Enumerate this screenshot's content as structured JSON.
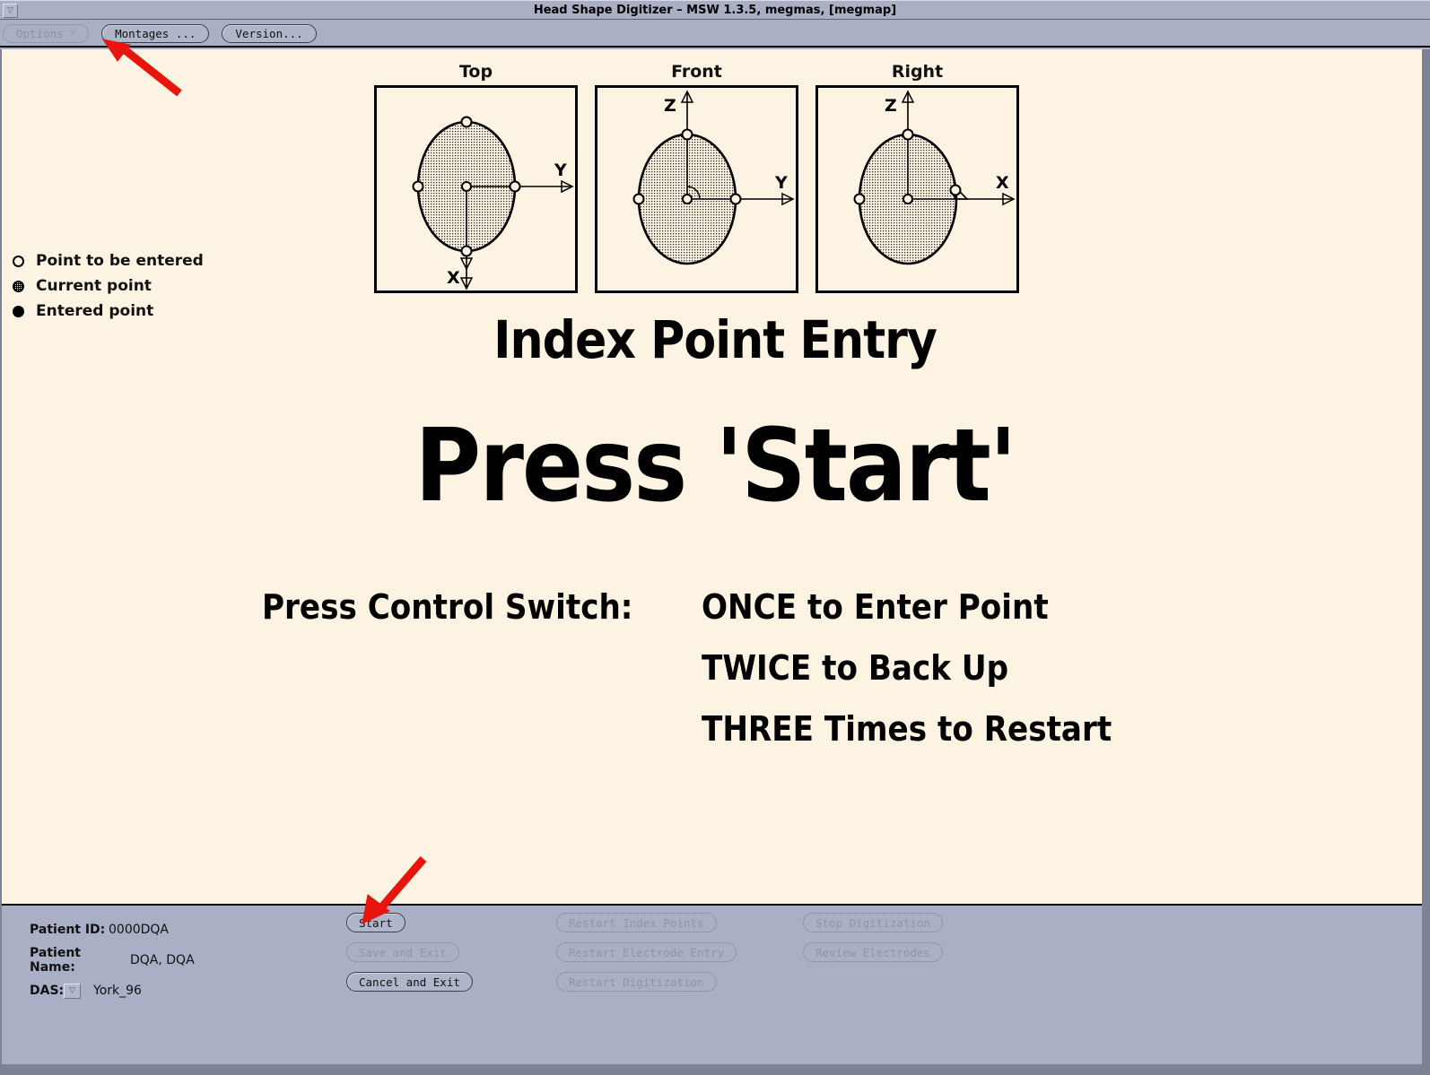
{
  "window": {
    "title": "Head Shape Digitizer – MSW 1.3.5, megmas, [megmap]",
    "handle_icon": "▽"
  },
  "menubar": {
    "items": [
      {
        "label": "Options",
        "caret": "▽",
        "enabled": false
      },
      {
        "label": "Montages ...",
        "caret": "",
        "enabled": true
      },
      {
        "label": "Version...",
        "caret": "",
        "enabled": true
      }
    ]
  },
  "views": [
    {
      "name": "Top",
      "axis_h": "Y",
      "axis_v": "X"
    },
    {
      "name": "Front",
      "axis_h": "Y",
      "axis_v": "Z"
    },
    {
      "name": "Right",
      "axis_h": "X",
      "axis_v": "Z"
    }
  ],
  "legend": [
    {
      "marker": "open-circle",
      "label": "Point to be entered"
    },
    {
      "marker": "stippled-circle",
      "label": "Current point"
    },
    {
      "marker": "filled-circle",
      "label": "Entered point"
    }
  ],
  "headings": {
    "section": "Index Point Entry",
    "prompt": "Press 'Start'"
  },
  "instructions": {
    "label": "Press Control Switch:",
    "lines": [
      "ONCE to Enter Point",
      "TWICE to Back Up",
      "THREE Times to Restart"
    ]
  },
  "patient": {
    "id_label": "Patient ID:",
    "id_value": "0000DQA",
    "name_label": "Patient Name:",
    "name_value": "DQA, DQA",
    "das_label": "DAS:",
    "das_value": "York_96",
    "das_caret": "▽"
  },
  "actions": {
    "column1": [
      {
        "label": "Start",
        "enabled": true
      },
      {
        "label": "Save and Exit",
        "enabled": false
      },
      {
        "label": "Cancel and Exit",
        "enabled": true
      }
    ],
    "column2": [
      {
        "label": "Restart Index Points",
        "enabled": false
      },
      {
        "label": "Restart Electrode Entry",
        "enabled": false
      },
      {
        "label": "Restart Digitization",
        "enabled": false
      }
    ],
    "column3": [
      {
        "label": "Stop Digitization",
        "enabled": false
      },
      {
        "label": "Review Electrodes",
        "enabled": false
      }
    ]
  },
  "colors": {
    "canvas_bg": "#fdf3e3",
    "panel_bg": "#a9afc4",
    "annotation_red": "#e8150f",
    "text": "#111111"
  },
  "annotations": [
    {
      "name": "arrow-to-montages",
      "target": "Montages ..."
    },
    {
      "name": "arrow-to-start",
      "target": "Start"
    }
  ]
}
